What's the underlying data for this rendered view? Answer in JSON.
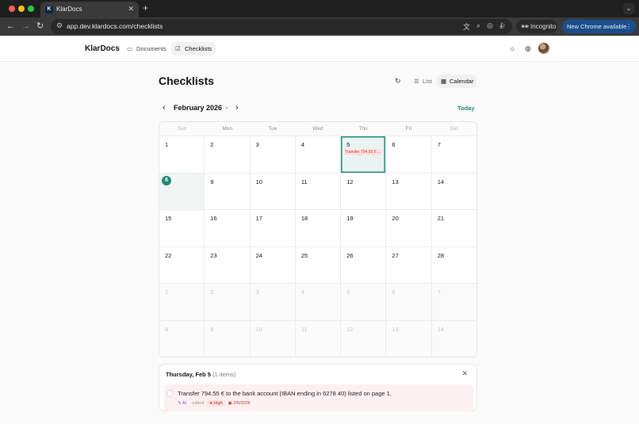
{
  "browser": {
    "tab_title": "KlarDocs",
    "tab_favicon": "K",
    "url": "app.dev.klardocs.com/checklists",
    "incognito_label": "Incognito",
    "update_label": "New Chrome available"
  },
  "app": {
    "logo": "KlarDocs",
    "nav": [
      {
        "label": "Documents",
        "icon": "folder-icon"
      },
      {
        "label": "Checklists",
        "icon": "checkbox-icon"
      }
    ]
  },
  "page": {
    "title": "Checklists",
    "view_options": [
      "List",
      "Calendar"
    ],
    "active_view": "Calendar",
    "month_label": "February 2026",
    "today_label": "Today",
    "weekdays": [
      "Sun",
      "Mon",
      "Tue",
      "Wed",
      "Thu",
      "Fri",
      "Sat"
    ]
  },
  "calendar": {
    "weeks": [
      [
        {
          "d": "1"
        },
        {
          "d": "2"
        },
        {
          "d": "3"
        },
        {
          "d": "4"
        },
        {
          "d": "5",
          "selected": true,
          "event": "Transfer 794.55 € ..."
        },
        {
          "d": "6"
        },
        {
          "d": "7"
        }
      ],
      [
        {
          "d": "8",
          "today": true
        },
        {
          "d": "9"
        },
        {
          "d": "10"
        },
        {
          "d": "11"
        },
        {
          "d": "12"
        },
        {
          "d": "13"
        },
        {
          "d": "14"
        }
      ],
      [
        {
          "d": "15"
        },
        {
          "d": "16"
        },
        {
          "d": "17"
        },
        {
          "d": "18"
        },
        {
          "d": "19"
        },
        {
          "d": "20"
        },
        {
          "d": "21"
        }
      ],
      [
        {
          "d": "22"
        },
        {
          "d": "23"
        },
        {
          "d": "24"
        },
        {
          "d": "25"
        },
        {
          "d": "26"
        },
        {
          "d": "27"
        },
        {
          "d": "28"
        }
      ],
      [
        {
          "d": "1",
          "other": true
        },
        {
          "d": "2",
          "other": true
        },
        {
          "d": "3",
          "other": true
        },
        {
          "d": "4",
          "other": true
        },
        {
          "d": "5",
          "other": true
        },
        {
          "d": "6",
          "other": true
        },
        {
          "d": "7",
          "other": true
        }
      ],
      [
        {
          "d": "8",
          "other": true
        },
        {
          "d": "9",
          "other": true
        },
        {
          "d": "10",
          "other": true
        },
        {
          "d": "11",
          "other": true
        },
        {
          "d": "12",
          "other": true
        },
        {
          "d": "13",
          "other": true
        },
        {
          "d": "14",
          "other": true
        }
      ]
    ]
  },
  "detail": {
    "date_label": "Thursday, Feb 5",
    "count_label": "(1 items)",
    "task": {
      "text": "Transfer 794.55 € to the bank account (IBAN ending in 6278 40) listed on page 1.",
      "source": "AI",
      "edited": "· edited",
      "priority": "High",
      "due": "2/5/2026"
    }
  },
  "colors": {
    "accent": "#1f8a7a",
    "danger": "#c0392b",
    "event_bg": "#fde2e2"
  }
}
